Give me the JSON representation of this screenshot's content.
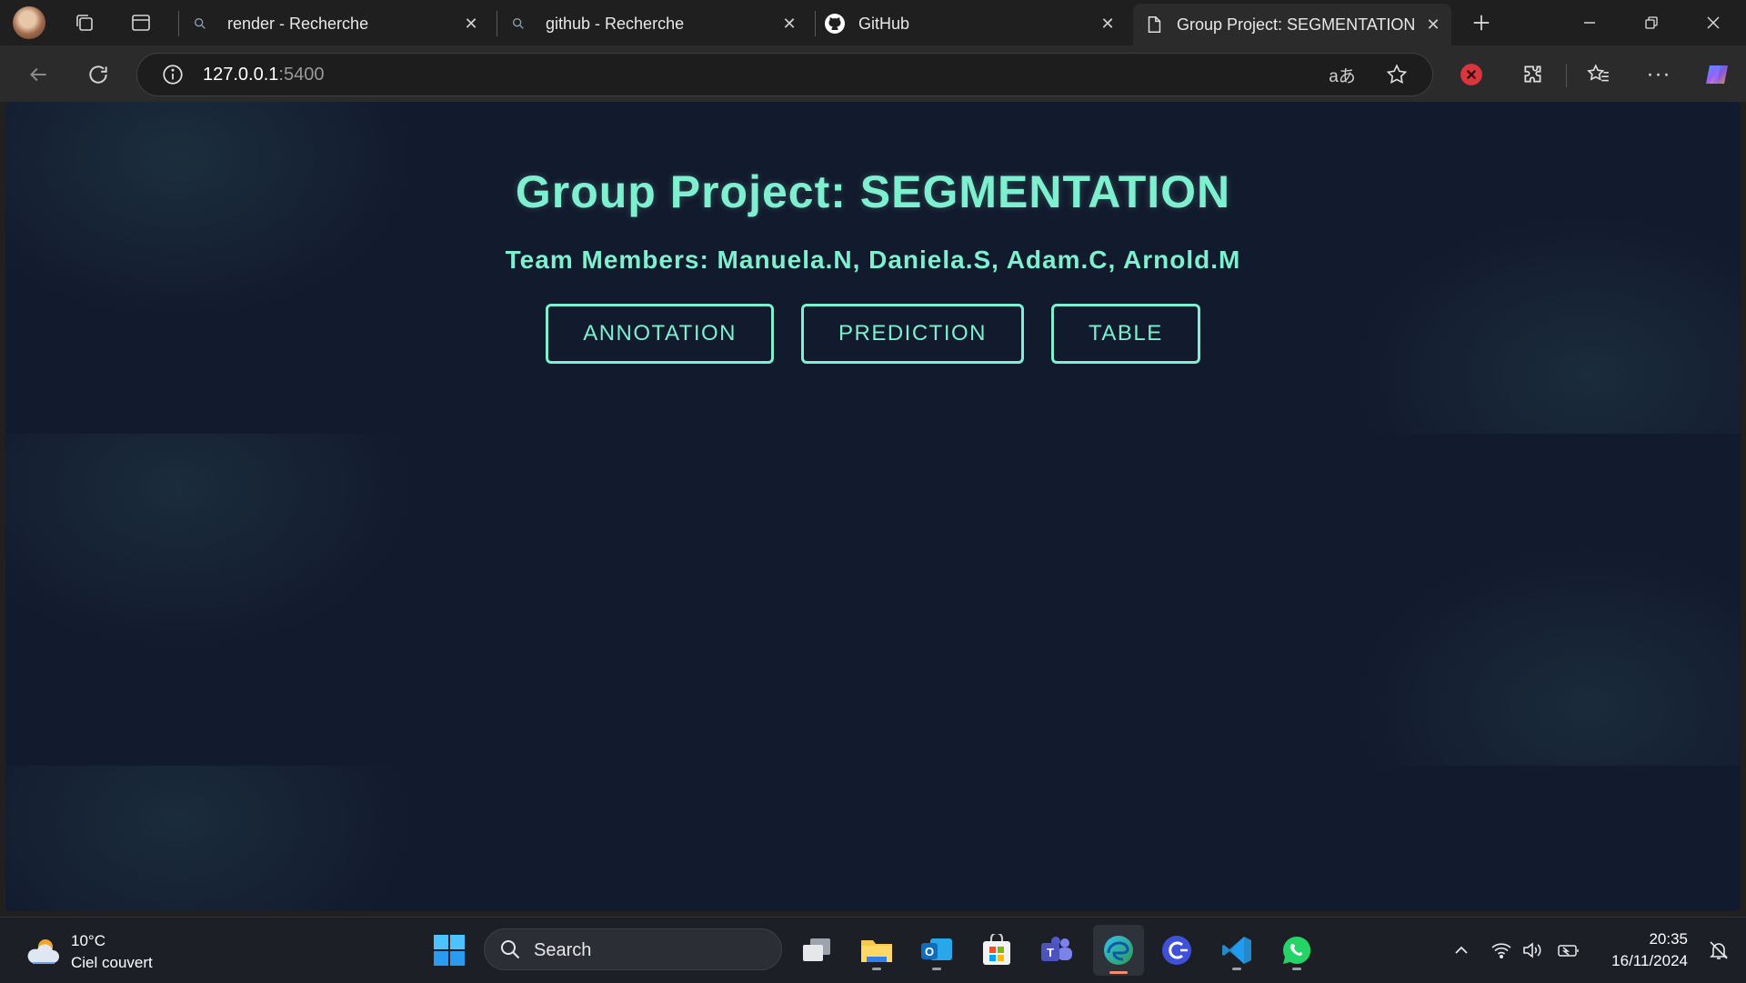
{
  "browser": {
    "tabs": [
      {
        "title": "render - Recherche",
        "icon": "search-icon"
      },
      {
        "title": "github - Recherche",
        "icon": "search-icon"
      },
      {
        "title": "GitHub",
        "icon": "github-icon"
      },
      {
        "title": "Group Project: SEGMENTATION",
        "icon": "page-icon",
        "active": true
      }
    ],
    "address": {
      "host": "127.0.0.1",
      "port": ":5400"
    }
  },
  "page": {
    "title": "Group Project: SEGMENTATION",
    "team": "Team Members: Manuela.N, Daniela.S, Adam.C, Arnold.M",
    "buttons": [
      "ANNOTATION",
      "PREDICTION",
      "TABLE"
    ],
    "accent_color": "#7ef0cf",
    "background_color": "#121a2d"
  },
  "taskbar": {
    "weather": {
      "temp": "10°C",
      "condition": "Ciel couvert"
    },
    "search_label": "Search",
    "time": "20:35",
    "date": "16/11/2024"
  }
}
